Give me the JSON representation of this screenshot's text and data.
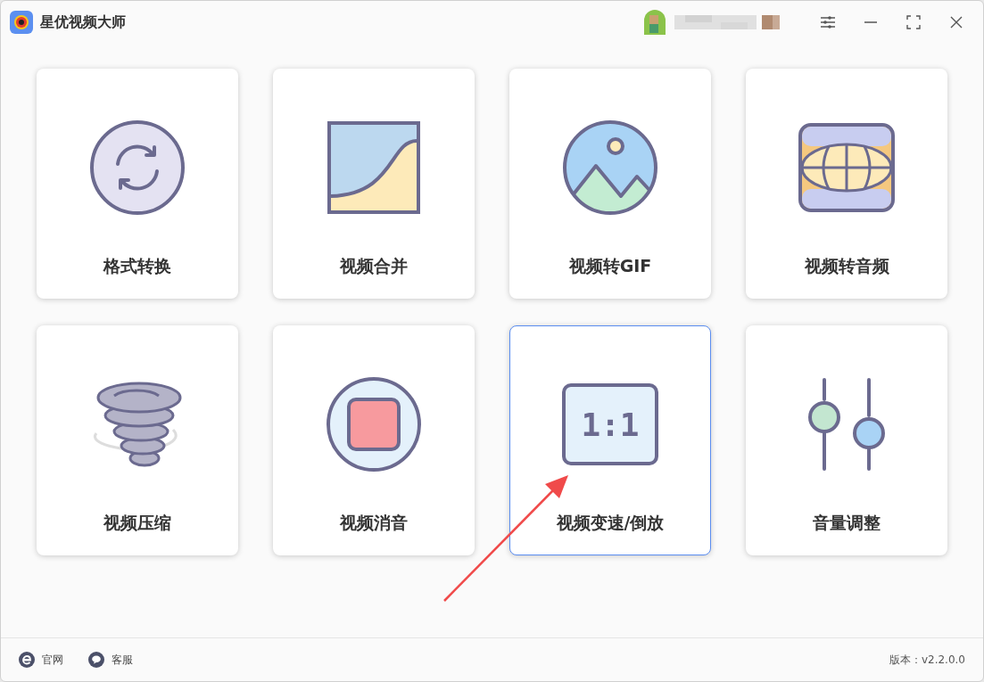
{
  "window": {
    "title": "星优视频大师"
  },
  "tools": [
    {
      "kind": "convert",
      "label": "格式转换",
      "selected": false
    },
    {
      "kind": "merge",
      "label": "视频合并",
      "selected": false
    },
    {
      "kind": "gif",
      "label": "视频转GIF",
      "selected": false
    },
    {
      "kind": "audio",
      "label": "视频转音频",
      "selected": false
    },
    {
      "kind": "compress",
      "label": "视频压缩",
      "selected": false
    },
    {
      "kind": "mute",
      "label": "视频消音",
      "selected": false
    },
    {
      "kind": "speed",
      "label": "视频变速/倒放",
      "selected": true,
      "icon_text": "1:1"
    },
    {
      "kind": "volume",
      "label": "音量调整",
      "selected": false
    }
  ],
  "footer": {
    "links": [
      {
        "kind": "web",
        "label": "官网"
      },
      {
        "kind": "chat",
        "label": "客服"
      }
    ],
    "version": "版本：v2.2.0.0"
  }
}
